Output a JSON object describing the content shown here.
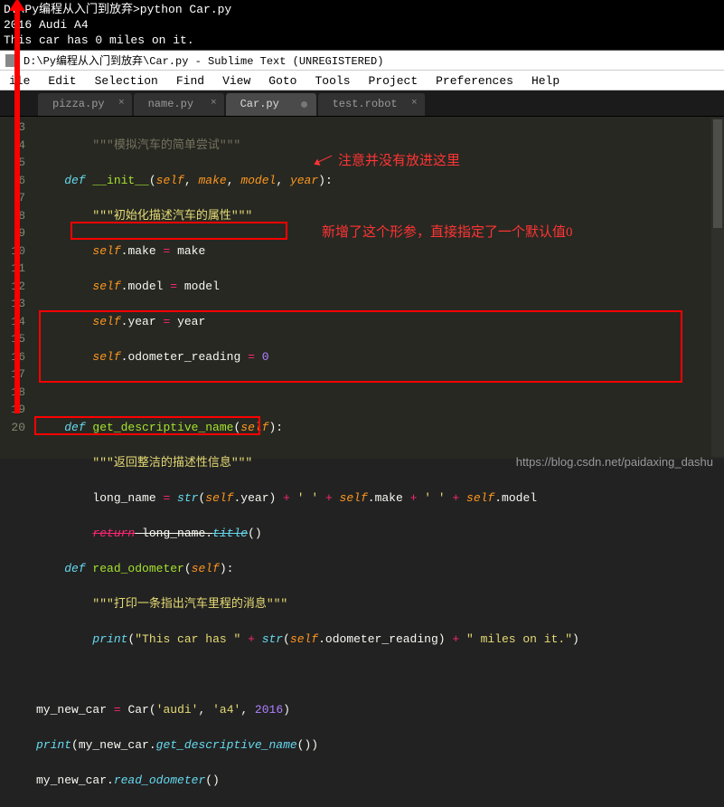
{
  "terminal": {
    "line1": "D:\\Py编程从入门到放弃>python Car.py",
    "line2": "2016 Audi A4",
    "line3": "This car has 0 miles on it."
  },
  "titlebar": {
    "text": "D:\\Py编程从入门到放弃\\Car.py - Sublime Text (UNREGISTERED)"
  },
  "menu": {
    "i0": "ile",
    "i1": "Edit",
    "i2": "Selection",
    "i3": "Find",
    "i4": "View",
    "i5": "Goto",
    "i6": "Tools",
    "i7": "Project",
    "i8": "Preferences",
    "i9": "Help"
  },
  "tabs": {
    "t0": "pizza.py",
    "t1": "name.py",
    "t2": "Car.py",
    "t3": "test.robot"
  },
  "gutter": {
    "l0": "",
    "l1": "3",
    "l2": "4",
    "l3": "5",
    "l4": "6",
    "l5": "7",
    "l6": "8",
    "l7": "9",
    "l8": "10",
    "l9": "11",
    "l10": "12",
    "l11": "13",
    "l12": "14",
    "l13": "15",
    "l14": "16",
    "l15": "17",
    "l16": "18",
    "l17": "19",
    "l18": "20"
  },
  "code": {
    "l0_c1": "\"\"\"模拟汽车的简单尝试\"\"\"",
    "l1_k": "def",
    "l1_fn": " __init__",
    "l1_w1": "(",
    "l1_p": "self",
    "l1_w2": ", ",
    "l1_a1": "make",
    "l1_w3": ", ",
    "l1_a2": "model",
    "l1_w4": ", ",
    "l1_a3": "year",
    "l1_w5": "):",
    "l2_s": "\"\"\"初始化描述汽车的属性\"\"\"",
    "l3_p": "self",
    "l3_w1": ".make ",
    "l3_k": "=",
    "l3_w2": " make",
    "l4_p": "self",
    "l4_w1": ".model ",
    "l4_k": "=",
    "l4_w2": " model",
    "l5_p": "self",
    "l5_w1": ".year ",
    "l5_k": "=",
    "l5_w2": " year",
    "l6_p": "self",
    "l6_w1": ".odometer_reading ",
    "l6_k": "=",
    "l6_n": " 0",
    "l8_k": "def",
    "l8_fn": " get_descriptive_name",
    "l8_w1": "(",
    "l8_p": "self",
    "l8_w2": "):",
    "l9_s": "\"\"\"返回整洁的描述性信息\"\"\"",
    "l10_w1": "long_name ",
    "l10_k1": "=",
    "l10_fn": " str",
    "l10_w2": "(",
    "l10_p": "self",
    "l10_w3": ".year) ",
    "l10_k2": "+",
    "l10_s1": " ' '",
    "l10_k3": " +",
    "l10_p2": " self",
    "l10_w4": ".make ",
    "l10_k4": "+",
    "l10_s2": " ' '",
    "l10_k5": " +",
    "l10_p3": " self",
    "l10_w5": ".model",
    "l11_k": "return",
    "l11_w": " long_name.",
    "l11_fn": "title",
    "l11_w2": "()",
    "l12_k": "def",
    "l12_fn": " read_odometer",
    "l12_w1": "(",
    "l12_p": "self",
    "l12_w2": "):",
    "l13_s": "\"\"\"打印一条指出汽车里程的消息\"\"\"",
    "l14_fn": "print",
    "l14_w1": "(",
    "l14_s1": "\"This car has \"",
    "l14_k1": " + ",
    "l14_fn2": "str",
    "l14_w2": "(",
    "l14_p": "self",
    "l14_w3": ".odometer_reading) ",
    "l14_k2": "+",
    "l14_s2": " \" miles on it.\"",
    "l14_w4": ")",
    "l16_w1": "my_new_car ",
    "l16_k": "=",
    "l16_fn": " Car",
    "l16_w2": "(",
    "l16_s1": "'audi'",
    "l16_w3": ", ",
    "l16_s2": "'a4'",
    "l16_w4": ", ",
    "l16_n": "2016",
    "l16_w5": ")",
    "l17_fn": "print",
    "l17_w1": "(my_new_car.",
    "l17_fn2": "get_descriptive_name",
    "l17_w2": "())",
    "l18_w1": "my_new_car.",
    "l18_fn": "read_odometer",
    "l18_w2": "()"
  },
  "ann": {
    "a1": "注意并没有放进这里",
    "a2": "新增了这个形参，直接指定了一个默认值0"
  },
  "watermark": "https://blog.csdn.net/paidaxing_dashu"
}
